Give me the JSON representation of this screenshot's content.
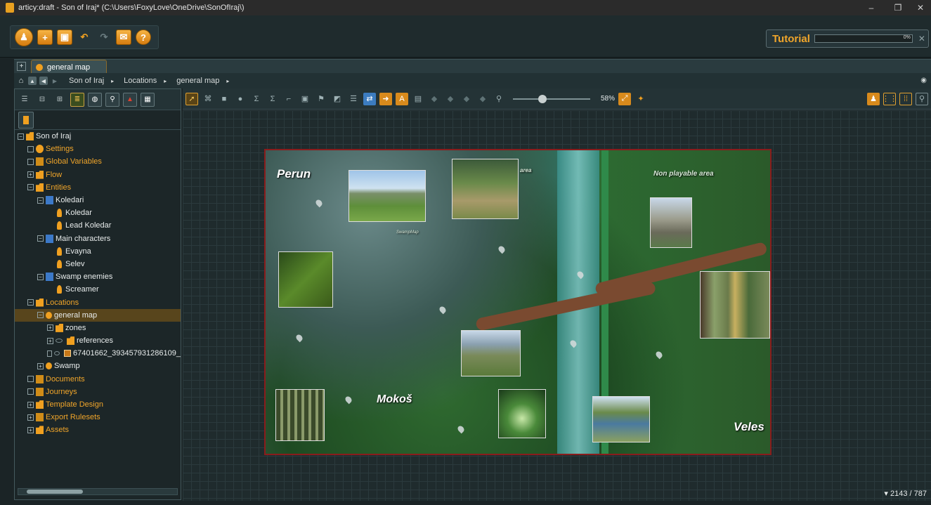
{
  "window": {
    "title": "articy:draft - Son of Iraj* (C:\\Users\\FoxyLove\\OneDrive\\SonOfIraj\\)",
    "minimize": "–",
    "maximize": "❐",
    "close": "✕"
  },
  "tutorial": {
    "label": "Tutorial",
    "percent": "0%",
    "close": "✕"
  },
  "tabs": {
    "plus": "+",
    "active": "general map"
  },
  "breadcrumb": {
    "items": [
      "Son of Iraj",
      "Locations",
      "general map"
    ],
    "sep": "▸"
  },
  "tree": [
    {
      "label": "Son of Iraj",
      "indent": 0,
      "exp": "−",
      "icon": "project",
      "color": "white"
    },
    {
      "label": "Settings",
      "indent": 1,
      "exp": "",
      "icon": "gear",
      "color": "orange"
    },
    {
      "label": "Global Variables",
      "indent": 1,
      "exp": "",
      "icon": "var",
      "color": "orange"
    },
    {
      "label": "Flow",
      "indent": 1,
      "exp": "+",
      "icon": "folder",
      "color": "orange"
    },
    {
      "label": "Entities",
      "indent": 1,
      "exp": "−",
      "icon": "folder",
      "color": "orange"
    },
    {
      "label": "Koledari",
      "indent": 2,
      "exp": "−",
      "icon": "char",
      "color": "white"
    },
    {
      "label": "Koledar",
      "indent": 3,
      "exp": "",
      "icon": "person",
      "color": "white"
    },
    {
      "label": "Lead Koledar",
      "indent": 3,
      "exp": "",
      "icon": "person",
      "color": "white"
    },
    {
      "label": "Main characters",
      "indent": 2,
      "exp": "−",
      "icon": "char",
      "color": "white"
    },
    {
      "label": "Evayna",
      "indent": 3,
      "exp": "",
      "icon": "person",
      "color": "white"
    },
    {
      "label": "Selev",
      "indent": 3,
      "exp": "",
      "icon": "person",
      "color": "white"
    },
    {
      "label": "Swamp enemies",
      "indent": 2,
      "exp": "−",
      "icon": "char",
      "color": "white"
    },
    {
      "label": "Screamer",
      "indent": 3,
      "exp": "",
      "icon": "person",
      "color": "white"
    },
    {
      "label": "Locations",
      "indent": 1,
      "exp": "−",
      "icon": "folder",
      "color": "orange"
    },
    {
      "label": "general map",
      "indent": 2,
      "exp": "−",
      "icon": "dot",
      "color": "white",
      "selected": true
    },
    {
      "label": "zones",
      "indent": 3,
      "exp": "+",
      "icon": "folder",
      "color": "white"
    },
    {
      "label": "references",
      "indent": 3,
      "exp": "+",
      "icon": "folder",
      "color": "white",
      "eye": true
    },
    {
      "label": "67401662_393457931286109_",
      "indent": 3,
      "exp": "",
      "icon": "img",
      "color": "white",
      "eye": true
    },
    {
      "label": "Swamp",
      "indent": 2,
      "exp": "+",
      "icon": "dot",
      "color": "white"
    },
    {
      "label": "Documents",
      "indent": 1,
      "exp": "",
      "icon": "doc",
      "color": "orange"
    },
    {
      "label": "Journeys",
      "indent": 1,
      "exp": "",
      "icon": "journey",
      "color": "orange"
    },
    {
      "label": "Template Design",
      "indent": 1,
      "exp": "+",
      "icon": "folder",
      "color": "orange"
    },
    {
      "label": "Export Rulesets",
      "indent": 1,
      "exp": "+",
      "icon": "export",
      "color": "orange"
    },
    {
      "label": "Assets",
      "indent": 1,
      "exp": "+",
      "icon": "folder",
      "color": "orange"
    }
  ],
  "canvas": {
    "zoom": "58%",
    "coords": "▾ 2143 / 787"
  },
  "map": {
    "labels": {
      "perun": "Perun",
      "mokos": "Mokoš",
      "veles": "Veles",
      "nonplay": "Non playable area",
      "area": "area",
      "swamp_ref": "SwampMap"
    }
  },
  "colors": {
    "accent": "#f0a52a",
    "frame": "#8a1c1c"
  }
}
